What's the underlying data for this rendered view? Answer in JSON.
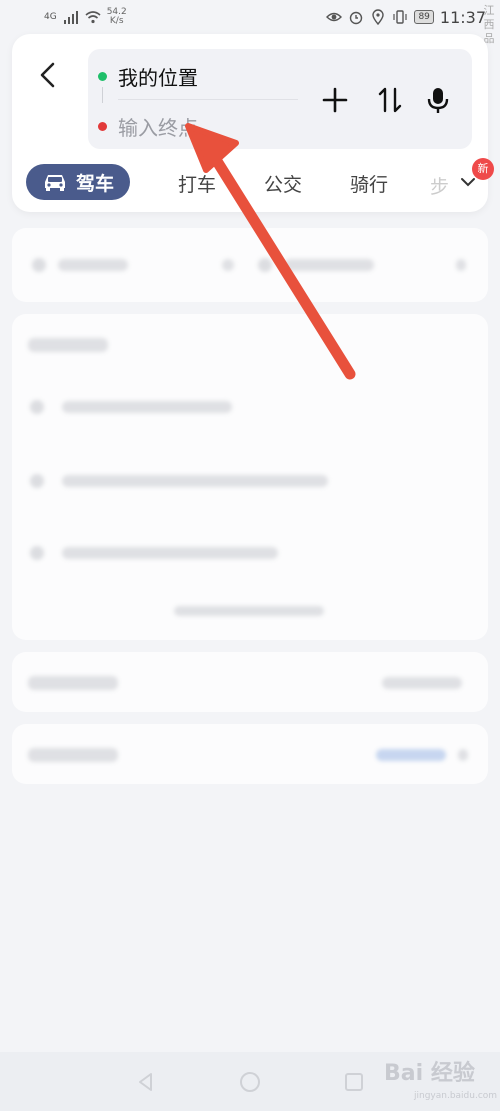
{
  "status_bar": {
    "network": "4G",
    "speed_value": "54.2",
    "speed_unit": "K/s",
    "battery": "89",
    "time": "11:37",
    "edge_text": "江西品"
  },
  "header": {
    "start_point": "我的位置",
    "end_placeholder": "输入终点"
  },
  "tabs": {
    "active_label": "驾车",
    "items": [
      "打车",
      "公交",
      "骑行"
    ],
    "more_fade": "步",
    "new_badge": "新"
  },
  "colors": {
    "active_tab": "#4a5b8c",
    "start_dot": "#1fbf6a",
    "end_dot": "#e23a3a",
    "annotation_arrow": "#e8513c",
    "new_badge": "#ef4a4a"
  },
  "watermark": {
    "brand": "Bai 经验",
    "url": "jingyan.baidu.com"
  }
}
